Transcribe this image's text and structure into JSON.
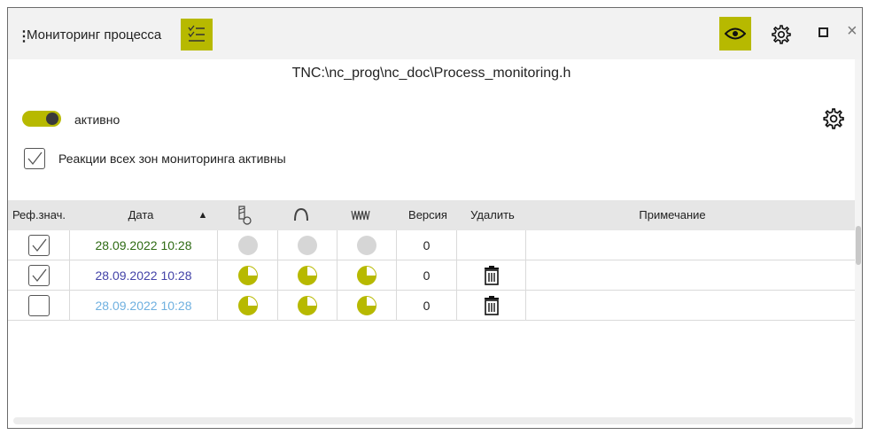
{
  "window": {
    "title": "Мониторинг процесса",
    "close_glyph": "×"
  },
  "path": "TNC:\\nc_prog\\nc_doc\\Process_monitoring.h",
  "toggle": {
    "label": "активно",
    "state": "on"
  },
  "all_zones": {
    "label": "Реакции всех зон мониторинга активны",
    "checked": true
  },
  "table": {
    "headers": {
      "ref": "Реф.знач.",
      "date": "Дата",
      "sort_glyph": "▲",
      "tool_icon": "tool-wear-icon",
      "spindle_icon": "spindle-icon",
      "vibration_icon": "vibration-icon",
      "version": "Версия",
      "delete": "Удалить",
      "note": "Примечание"
    },
    "rows": [
      {
        "checked": true,
        "date": "28.09.2022 10:28",
        "date_color": "#2e6b14",
        "status": "grey",
        "version": "0",
        "deletable": false,
        "note": ""
      },
      {
        "checked": true,
        "date": "28.09.2022 10:28",
        "date_color": "#4343a8",
        "status": "partial",
        "version": "0",
        "deletable": true,
        "note": ""
      },
      {
        "checked": false,
        "date": "28.09.2022 10:28",
        "date_color": "#6fb0e0",
        "status": "partial",
        "version": "0",
        "deletable": true,
        "note": ""
      }
    ]
  },
  "colors": {
    "accent": "#b7b900",
    "header_bg": "#e6e6e6",
    "titlebar_bg": "#f2f2f2"
  }
}
